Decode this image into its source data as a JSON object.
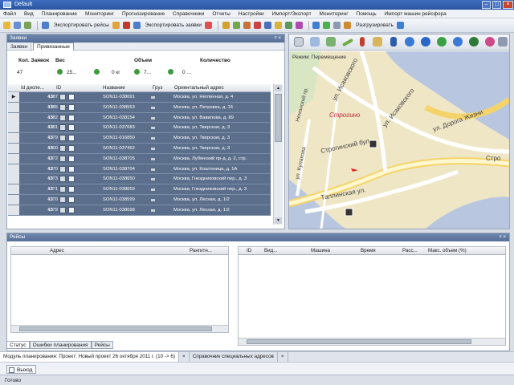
{
  "window": {
    "title": "Default"
  },
  "menu": [
    "Файл",
    "Вид",
    "Планирование",
    "Мониторинг",
    "Прогнозирование",
    "Справочники",
    "Отчеты",
    "Настройки",
    "Импорт/Экспорт",
    "Мониторинг",
    "Помощь",
    "Импорт машин рейсфора"
  ],
  "toolbar": {
    "export_routes": "Экспортировать рейсы",
    "export_orders": "Экспортировать заявки",
    "unload": "Разгрузировать"
  },
  "orders_panel": {
    "title": "Заявки",
    "tabs": [
      "Заявки",
      "Привязанные"
    ],
    "summary": {
      "col_count_label": "Кол. Заявок",
      "col_weight_label": "Вес",
      "col_volume_label": "Объем",
      "col_qty_label": "Количество",
      "count_value": "47",
      "weight_value": "25...",
      "weight_unit": "0 кг",
      "volume_value": "7...",
      "volume_unit": "0 ..."
    },
    "columns": [
      "Id диспе...",
      "ID",
      "",
      "",
      "Название",
      "",
      "Груз",
      "Ориентальный адрес"
    ],
    "rows": [
      {
        "disp": "13",
        "id": "4387",
        "name": "SON11-038691",
        "addr": "Москва, ул. Неглинная, д. 4"
      },
      {
        "disp": "13",
        "id": "4385",
        "name": "SON11-038553",
        "addr": "Москва, ул. Петровка, д. 16"
      },
      {
        "disp": "13",
        "id": "4382",
        "name": "SON11-038154",
        "addr": "Москва, ул. Вавилова, д. 89"
      },
      {
        "disp": "13",
        "id": "4381",
        "name": "SON11-037683",
        "addr": "Москва, ул. Тверская, д. 3"
      },
      {
        "disp": "13",
        "id": "4379",
        "name": "SON11-016850",
        "addr": "Москва, ул. Тверская, д. 3"
      },
      {
        "disp": "13",
        "id": "4300",
        "name": "SON11-037452",
        "addr": "Москва, ул. Тверская, д. 3"
      },
      {
        "disp": "13",
        "id": "4372",
        "name": "SON11-038705",
        "addr": "Москва, Лубянский пр-д, д. 2, стр."
      },
      {
        "disp": "13",
        "id": "4370",
        "name": "SON11-038704",
        "addr": "Москва, ул. Коштоница, д. 1А"
      },
      {
        "disp": "13",
        "id": "4373",
        "name": "SON11-038650",
        "addr": "Москва, Гнездниковский пер., д. 3"
      },
      {
        "disp": "13",
        "id": "4371",
        "name": "SON11-038659",
        "addr": "Москва, Гнездниковский пер., д. 3"
      },
      {
        "disp": "13",
        "id": "4370",
        "name": "SON11-038599",
        "addr": "Москва, ул. Лесная, д. 1/2"
      },
      {
        "disp": "13",
        "id": "4379",
        "name": "SON11-038698",
        "addr": "Москва, ул. Лесная, д. 1/2"
      }
    ]
  },
  "map_panel": {
    "mode_label": "Режим: Перемещение",
    "streets": [
      "ул. Исаковского",
      "ул. Исаковского",
      "ул. Дорога Жизни",
      "Неманский пр.",
      "Строгино",
      "Строгинский бул.",
      "ул. Кулакова",
      "Таллинская ул.",
      "Стро"
    ]
  },
  "routes_panel": {
    "title": "Рейсы",
    "left_columns": [
      "",
      "",
      "Адрес",
      "Рангитн..."
    ],
    "right_columns": [
      "ID",
      "Вид...",
      "Машина",
      "Время",
      "Расс...",
      "Макс. объем (%)"
    ]
  },
  "bottom_tabs": [
    "Статус",
    "Ошибки планирования",
    "Рейсы"
  ],
  "doc_tabs": [
    "Модуль планирования: Проект: Новый проект 26 октября 2011 г. (10 -> 6)",
    "Справочник специальных адресов"
  ],
  "exit_label": "Выход",
  "status": "Готово",
  "colors": {
    "selected_row": "#5b6f8c",
    "panel_header": "#566f98",
    "accent": "#3e6ec0"
  }
}
